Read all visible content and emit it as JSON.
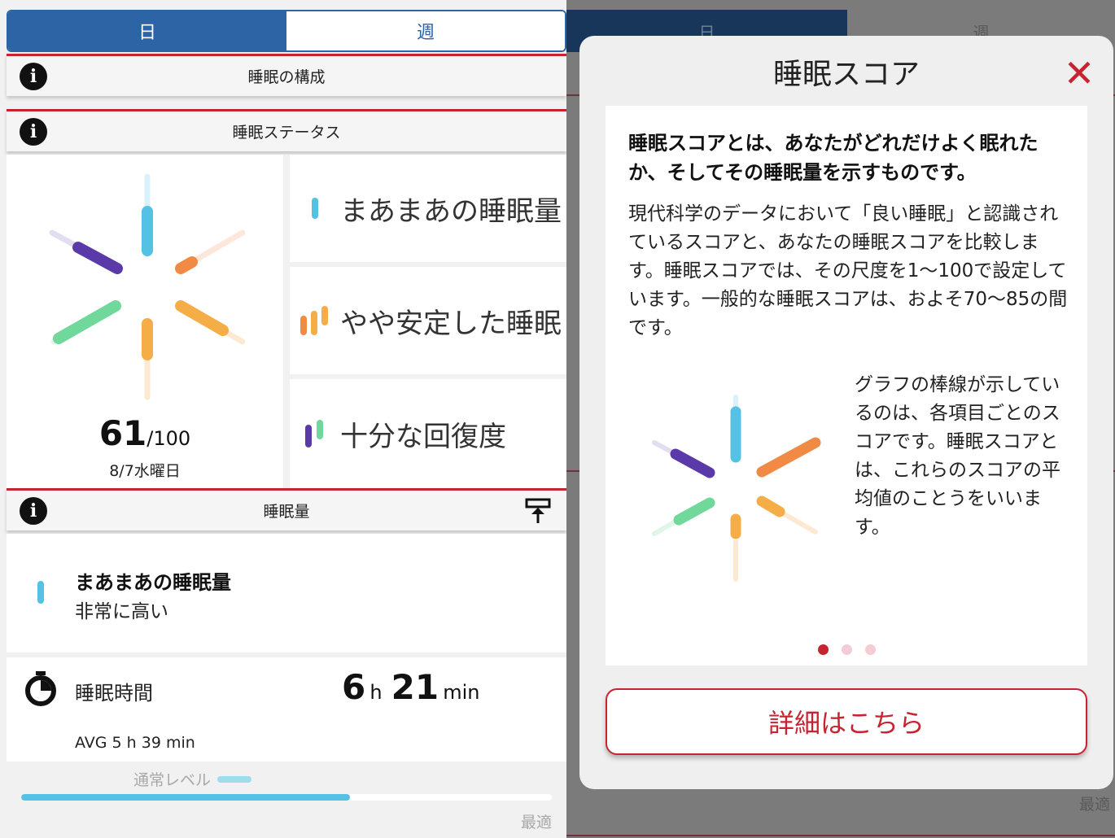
{
  "tabs": {
    "day": "日",
    "week": "週"
  },
  "sections": {
    "composition": "睡眠の構成",
    "status": "睡眠ステータス",
    "quantity": "睡眠量"
  },
  "status_cards": [
    {
      "label": "まあまあの睡眠量",
      "icon": "blue-bar-icon"
    },
    {
      "label": "やや安定した睡眠",
      "icon": "orange-bars-icon"
    },
    {
      "label": "十分な回復度",
      "icon": "purple-green-bars-icon"
    }
  ],
  "score": {
    "value": "61",
    "max": "/100",
    "date": "8/7水曜日"
  },
  "quantity": {
    "title": "まあまあの睡眠量",
    "level": "非常に高い"
  },
  "duration": {
    "label": "睡眠時間",
    "hours": "6",
    "hours_unit": "h",
    "minutes": "21",
    "minutes_unit": "min",
    "avg": "AVG 5 h 39 min"
  },
  "level_bar": {
    "label": "通常レベル",
    "optimal": "最適",
    "progress": 0.62
  },
  "background": {
    "tab_day": "日",
    "tab_week": "週",
    "optimal": "最適"
  },
  "modal": {
    "title": "睡眠スコア",
    "close": "✕",
    "heading": "睡眠スコアとは、あなたがどれだけよく眠れたか、そしてその睡眠量を示すものです。",
    "body": "現代科学のデータにおいて「良い睡眠」と認識されているスコアと、あなたの睡眠スコアを比較します。睡眠スコアでは、その尺度を1〜100で設定しています。一般的な睡眠スコアは、およそ70〜85の間です。",
    "side_text": "グラフの棒線が示しているのは、各項目ごとのスコアです。睡眠スコアとは、これらのスコアの平均値のことうをいいます。",
    "page_count": 3,
    "current_page": 1,
    "button": "詳細はこちら"
  },
  "colors": {
    "primary": "#2d64a6",
    "accent_red": "#c8242f",
    "blue": "#54c1e5",
    "orange": "#f08a44",
    "amber": "#f5ad47",
    "purple": "#5a3aa8",
    "green": "#6fd89a"
  },
  "icons": [
    "info-icon",
    "export-icon",
    "stopwatch-icon",
    "close-icon"
  ]
}
